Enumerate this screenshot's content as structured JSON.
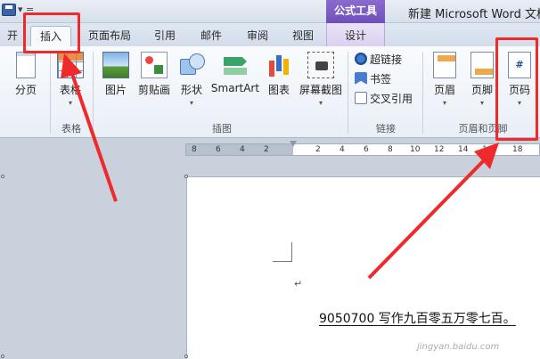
{
  "titlebar": {
    "qat_more": "▾ =",
    "context_tab_head": "公式工具",
    "doc_title": "新建 Microsoft Word 文档"
  },
  "tabs": [
    {
      "label": "开始",
      "active": false
    },
    {
      "label": "插入",
      "active": true
    },
    {
      "label": "页面布局",
      "active": false
    },
    {
      "label": "引用",
      "active": false
    },
    {
      "label": "邮件",
      "active": false
    },
    {
      "label": "审阅",
      "active": false
    },
    {
      "label": "视图",
      "active": false
    },
    {
      "label": "设计",
      "active": false
    }
  ],
  "ribbon": {
    "pages": {
      "page_break": "分页",
      "cover_glyph": "▾"
    },
    "tables": {
      "table": "表格",
      "group": "表格"
    },
    "illustrations": {
      "picture": "图片",
      "clipart": "剪贴画",
      "shapes": "形状",
      "smartart": "SmartArt",
      "chart": "图表",
      "screenshot": "屏幕截图",
      "group": "插图"
    },
    "links": {
      "hyperlink": "超链接",
      "bookmark": "书签",
      "crossref": "交叉引用",
      "group": "链接"
    },
    "header_footer": {
      "header": "页眉",
      "footer": "页脚",
      "page_number": "页码",
      "page_number_glyph": "#",
      "group": "页眉和页脚"
    },
    "drop_glyph": "▾"
  },
  "ruler": {
    "ticks": [
      "8",
      "6",
      "4",
      "2",
      "",
      "2",
      "4",
      "6",
      "8",
      "10",
      "12",
      "14",
      "16",
      "18"
    ]
  },
  "document": {
    "para_mark": "↵",
    "text": "9050700 写作九百零五万零七百。",
    "watermark": "jingyan.baidu.com"
  },
  "colors": {
    "annotation_red": "#ee2a2a",
    "context_purple": "#7a5bc2"
  }
}
